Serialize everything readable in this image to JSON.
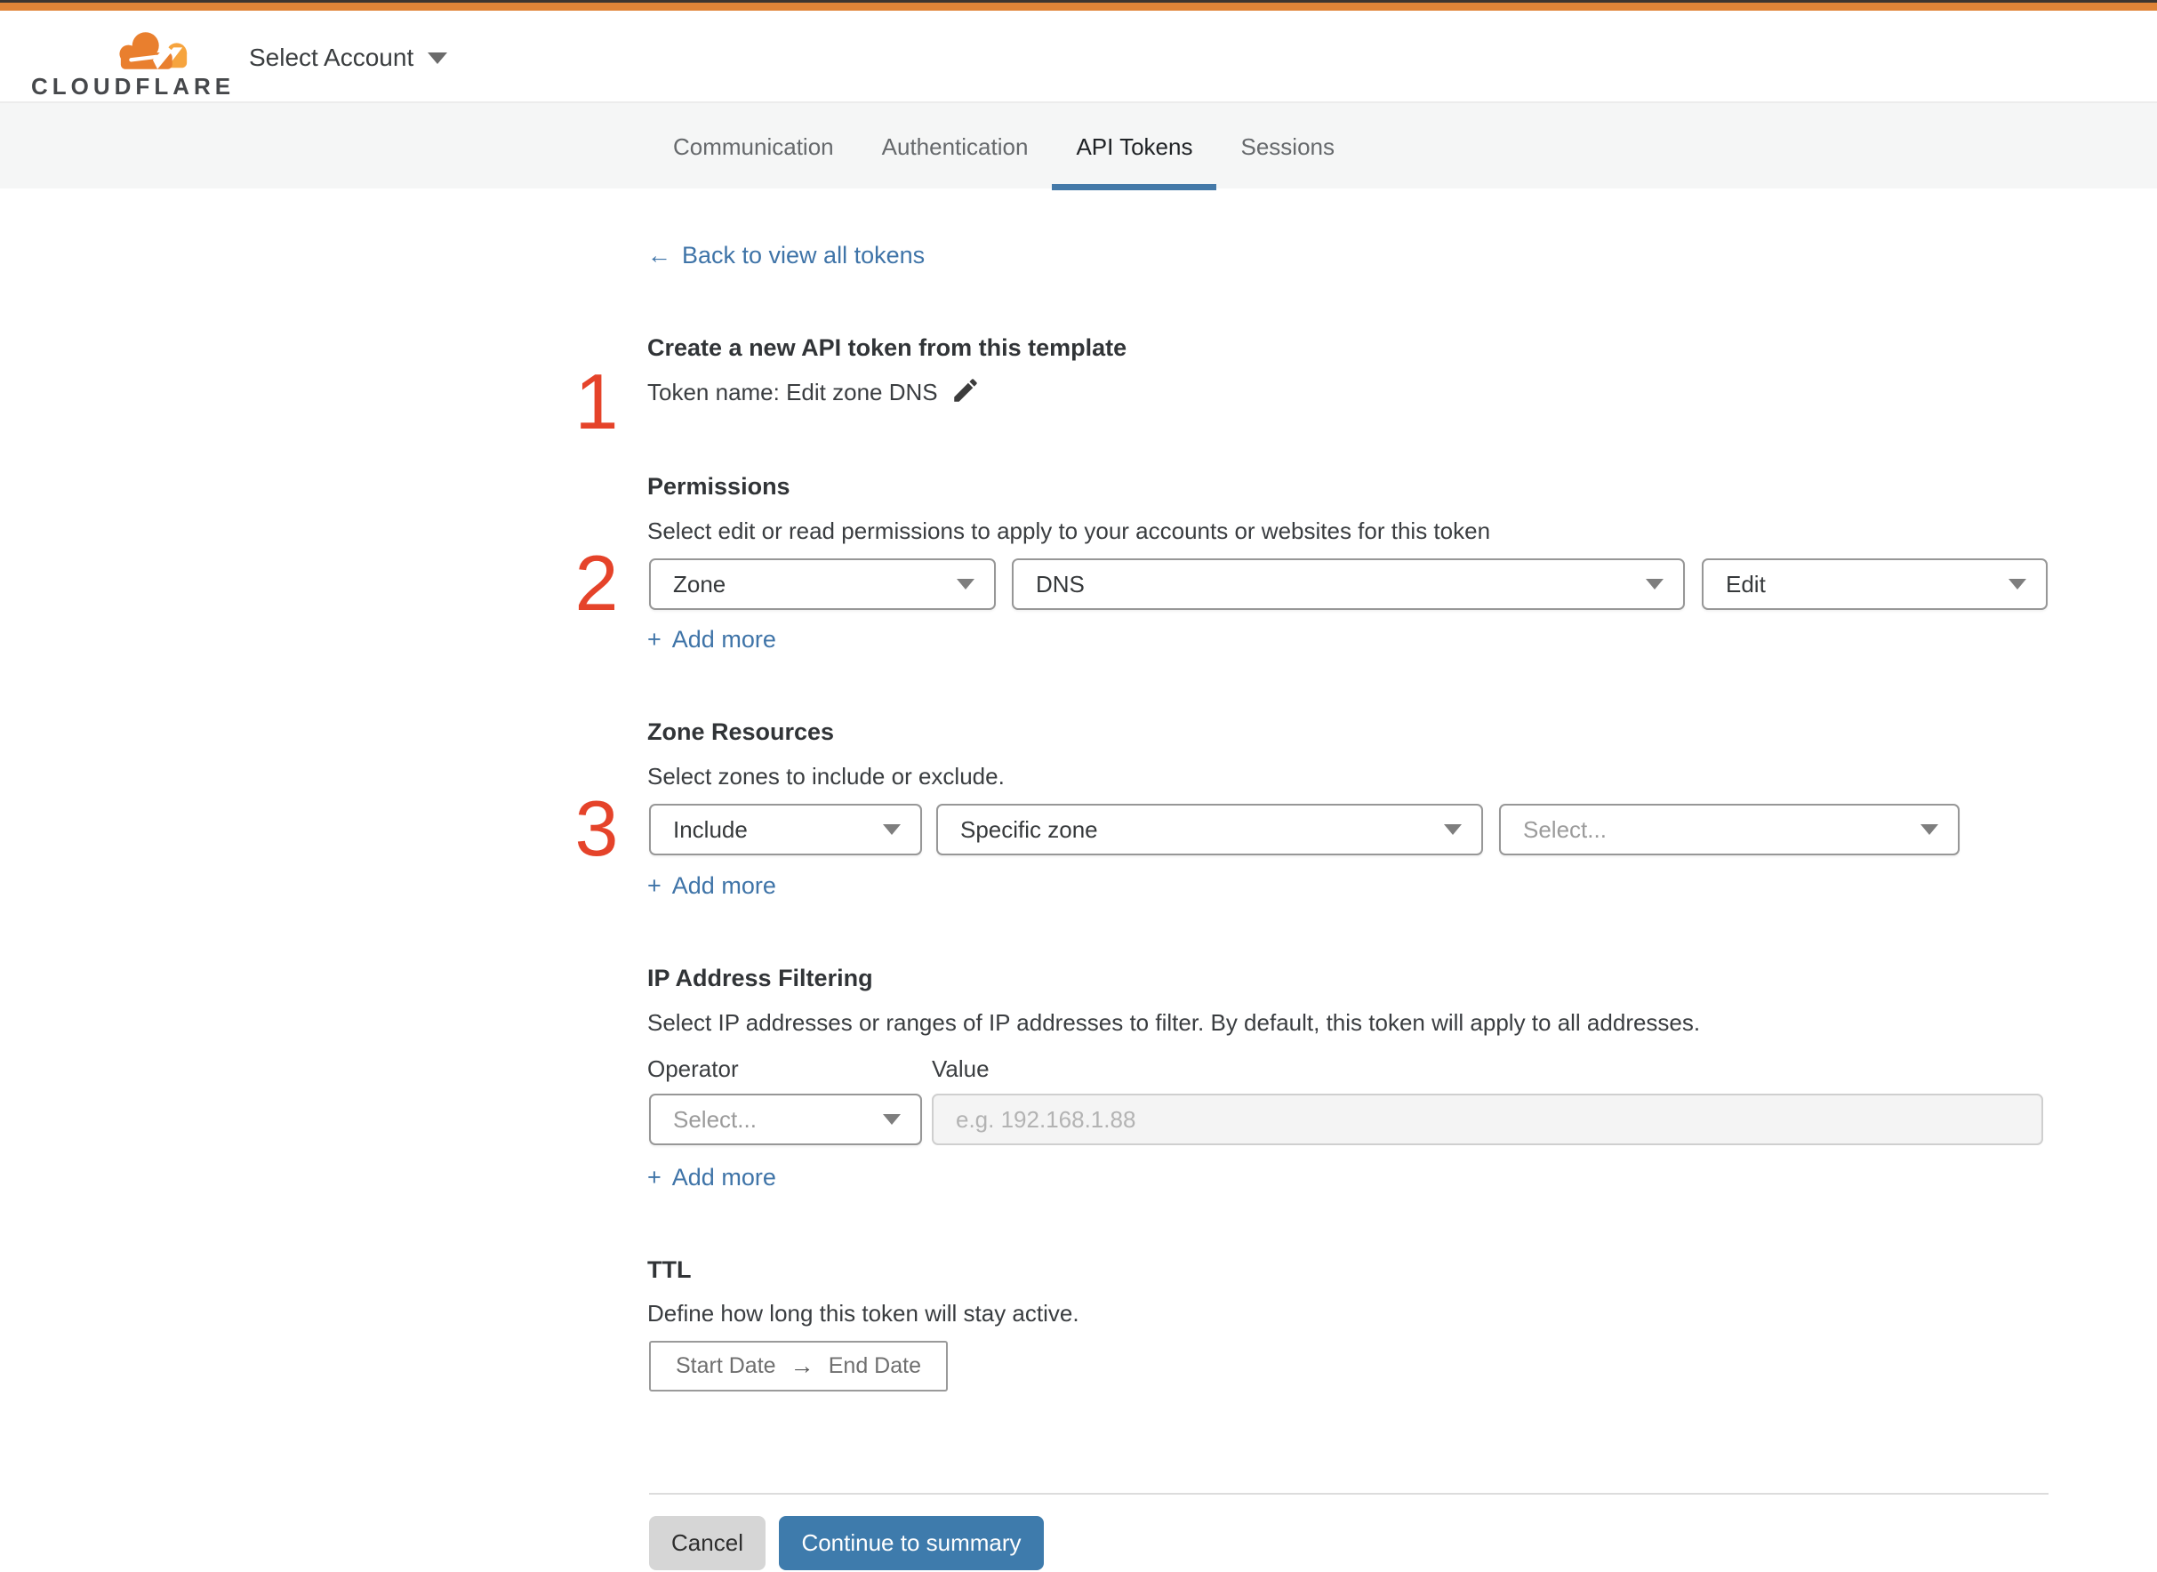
{
  "header": {
    "logo_text": "CLOUDFLARE",
    "account_selector": "Select Account"
  },
  "tabs": [
    {
      "label": "Communication",
      "active": false
    },
    {
      "label": "Authentication",
      "active": false
    },
    {
      "label": "API Tokens",
      "active": true
    },
    {
      "label": "Sessions",
      "active": false
    }
  ],
  "back_link": {
    "arrow": "←",
    "label": "Back to view all tokens"
  },
  "steps": {
    "one": "1",
    "two": "2",
    "three": "3"
  },
  "labels": {
    "add_more_plus": "+",
    "add_more": "Add more"
  },
  "template_section": {
    "heading": "Create a new API token from this template",
    "token_name": "Token name: Edit zone DNS"
  },
  "permissions": {
    "heading": "Permissions",
    "description": "Select edit or read permissions to apply to your accounts or websites for this token",
    "scope_value": "Zone",
    "resource_value": "DNS",
    "access_value": "Edit"
  },
  "zone_resources": {
    "heading": "Zone Resources",
    "description": "Select zones to include or exclude.",
    "operator_value": "Include",
    "type_value": "Specific zone",
    "zone_placeholder": "Select..."
  },
  "ip_filtering": {
    "heading": "IP Address Filtering",
    "description": "Select IP addresses or ranges of IP addresses to filter. By default, this token will apply to all addresses.",
    "operator_label": "Operator",
    "value_label": "Value",
    "operator_placeholder": "Select...",
    "value_placeholder": "e.g. 192.168.1.88"
  },
  "ttl": {
    "heading": "TTL",
    "description": "Define how long this token will stay active.",
    "start_label": "Start Date",
    "arrow": "→",
    "end_label": "End Date"
  },
  "footer": {
    "cancel_label": "Cancel",
    "continue_label": "Continue to summary"
  },
  "colors": {
    "top_bar_orange": "#e08437",
    "brand_orange": "#e97f2e",
    "brand_orange_light": "#f6a43e",
    "link_blue": "#3f74a8",
    "active_tab_blue": "#4479a8",
    "button_blue": "#3e7bac",
    "step_number_red": "#e5432a",
    "tab_band_gray": "#f5f6f6"
  }
}
